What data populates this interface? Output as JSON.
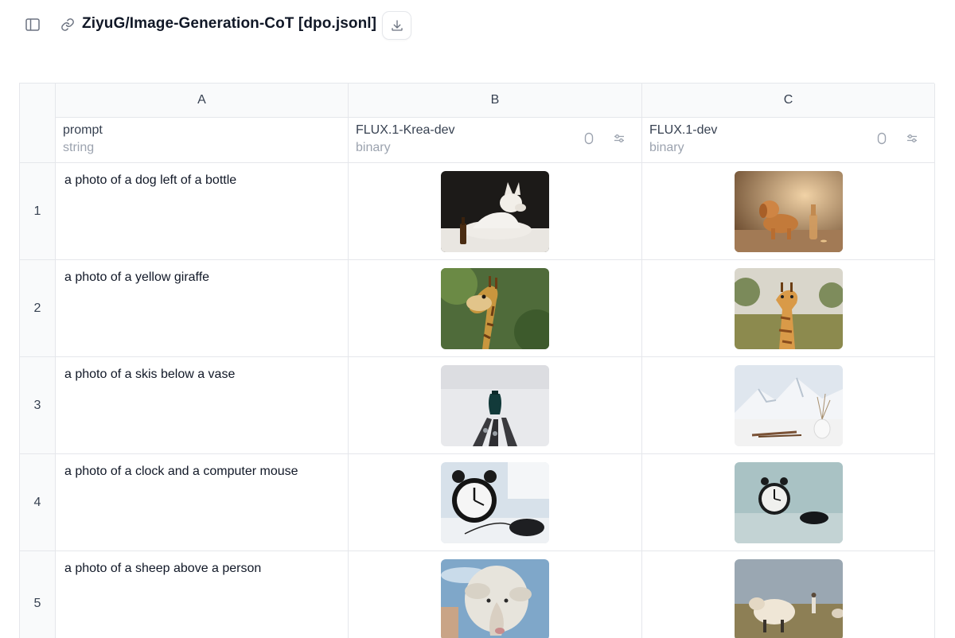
{
  "header": {
    "title": "ZiyuG/Image-Generation-CoT [dpo.jsonl]"
  },
  "icons": {
    "sidebar": "sidebar-toggle-icon",
    "link": "link-icon",
    "download": "download-icon",
    "sort": "sort-icon",
    "settings": "sliders-icon"
  },
  "colors": {
    "border": "#e5e7eb",
    "header_bg": "#f9fafb",
    "muted_text": "#9ca3af"
  },
  "columns": [
    {
      "letter": "A",
      "name": "prompt",
      "type": "string"
    },
    {
      "letter": "B",
      "name": "FLUX.1-Krea-dev",
      "type": "binary"
    },
    {
      "letter": "C",
      "name": "FLUX.1-dev",
      "type": "binary"
    }
  ],
  "rows": [
    {
      "index": "1",
      "prompt": "a photo of a dog left of a bottle"
    },
    {
      "index": "2",
      "prompt": "a photo of a yellow giraffe"
    },
    {
      "index": "3",
      "prompt": "a photo of a skis below a vase"
    },
    {
      "index": "4",
      "prompt": "a photo of a clock and a computer mouse"
    },
    {
      "index": "5",
      "prompt": "a photo of a sheep above a person"
    }
  ]
}
